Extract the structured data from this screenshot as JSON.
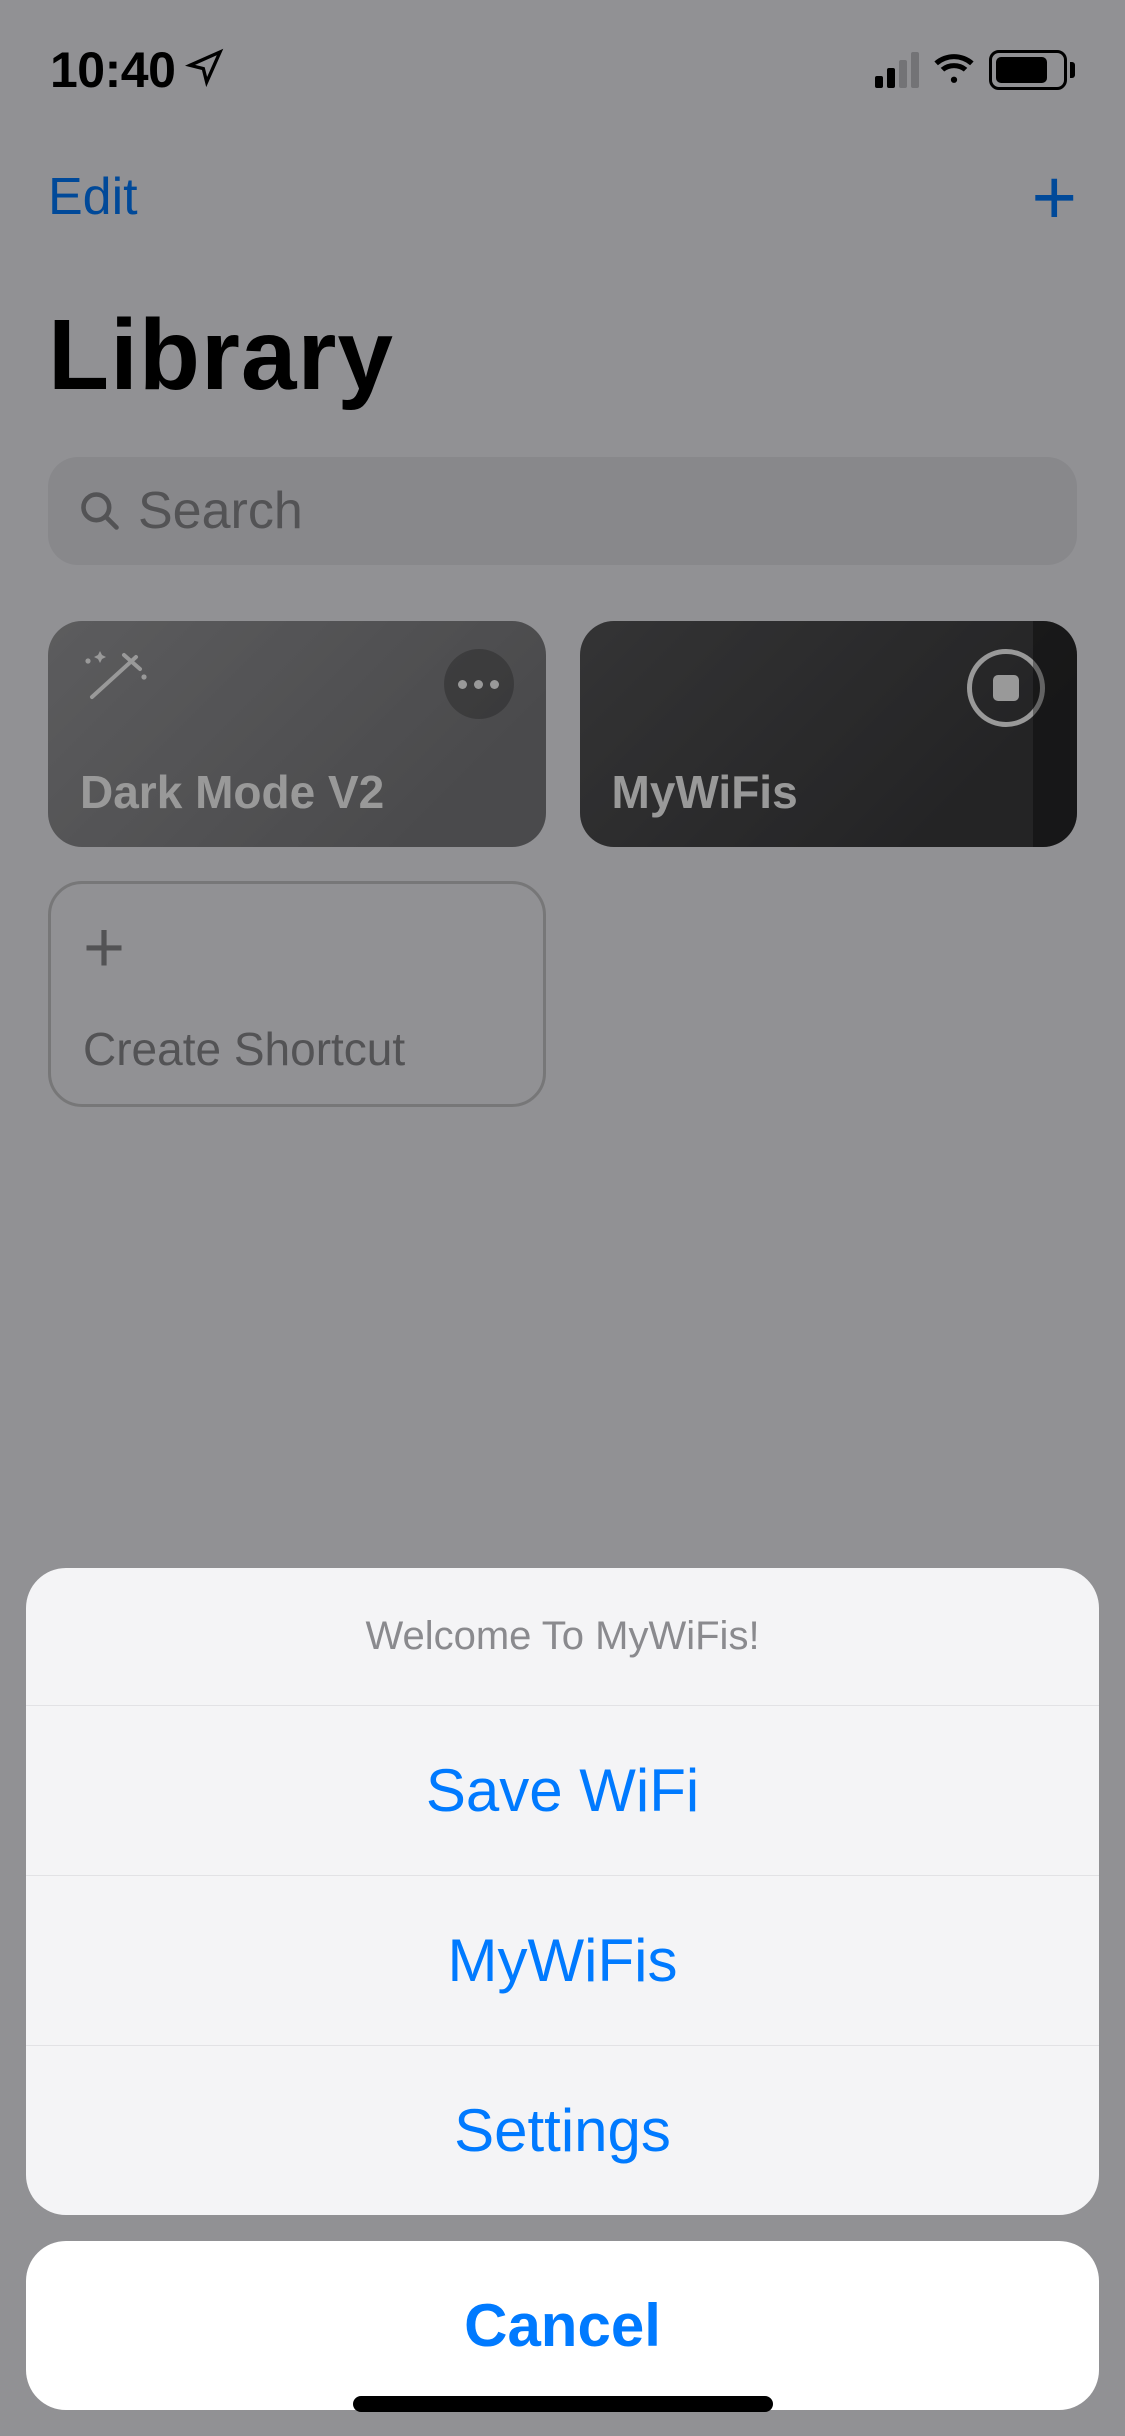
{
  "status": {
    "time": "10:40"
  },
  "nav": {
    "edit": "Edit"
  },
  "page": {
    "title": "Library"
  },
  "search": {
    "placeholder": "Search"
  },
  "tiles": [
    {
      "label": "Dark Mode V2"
    },
    {
      "label": "MyWiFis"
    }
  ],
  "create": {
    "label": "Create Shortcut"
  },
  "sheet": {
    "title": "Welcome To MyWiFis!",
    "items": [
      "Save WiFi",
      "MyWiFis",
      "Settings"
    ],
    "cancel": "Cancel"
  }
}
